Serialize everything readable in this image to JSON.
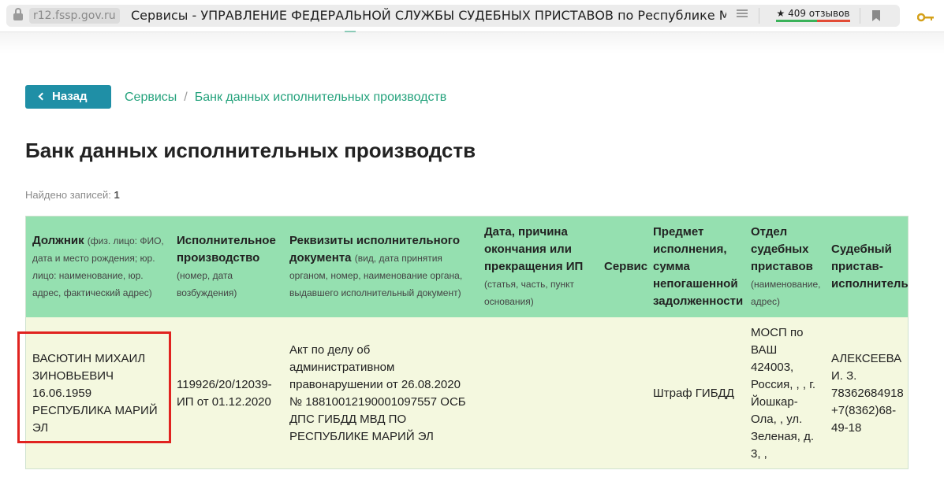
{
  "browser": {
    "domain": "r12.fssp.gov.ru",
    "page_title": "Сервисы - УПРАВЛЕНИЕ ФЕДЕРАЛЬНОЙ СЛУЖБЫ СУДЕБНЫХ ПРИСТАВОВ по Республике М...",
    "reviews_label": "★ 409 отзывов"
  },
  "nav": {
    "back_label": "Назад",
    "breadcrumb": [
      "Сервисы",
      "/",
      "Банк данных исполнительных производств"
    ]
  },
  "page": {
    "heading": "Банк данных исполнительных производств",
    "records_label": "Найдено записей:",
    "records_count": "1"
  },
  "table": {
    "headers": [
      {
        "title": "Должник",
        "sub": "(физ. лицо: ФИО, дата и место рождения; юр. лицо: наименование, юр. адрес, фактический адрес)"
      },
      {
        "title": "Исполнительное производство",
        "sub": "(номер, дата возбуждения)"
      },
      {
        "title": "Реквизиты исполнительного документа",
        "sub": "(вид, дата принятия органом, номер, наименование органа, выдавшего исполнительный документ)"
      },
      {
        "title": "Дата, причина окончания или прекращения ИП",
        "sub": "(статья, часть, пункт основания)"
      },
      {
        "title": "Сервис",
        "sub": ""
      },
      {
        "title": "Предмет исполнения, сумма непогашенной задолженности",
        "sub": ""
      },
      {
        "title": "Отдел судебных приставов",
        "sub": "(наименование, адрес)"
      },
      {
        "title": "Судебный пристав-исполнитель",
        "sub": ""
      }
    ],
    "rows": [
      {
        "debtor": "ВАСЮТИН МИХАИЛ ЗИНОВЬЕВИЧ 16.06.1959 РЕСПУБЛИКА МАРИЙ ЭЛ",
        "proceeding": "119926/20/12039-ИП от 01.12.2020",
        "document": "Акт по делу об административном правонарушении от 26.08.2020 № 18810012190001097557 ОСБ ДПС ГИБДД МВД ПО РЕСПУБЛИКЕ МАРИЙ ЭЛ",
        "end_reason": "",
        "service": "",
        "subject": "Штраф ГИБДД",
        "department": "МОСП по ВАШ 424003, Россия, , , г. Йошкар-Ола, , ул. Зеленая, д. 3, ,",
        "bailiff": "АЛЕКСЕЕВА И. З. 78362684918 +7(8362)68-49-18"
      }
    ]
  },
  "colors": {
    "accent": "#1f8fa6",
    "link": "#24a27c",
    "table_header": "#95e0b0",
    "table_row": "#f4f8df",
    "highlight": "#e0231f"
  }
}
